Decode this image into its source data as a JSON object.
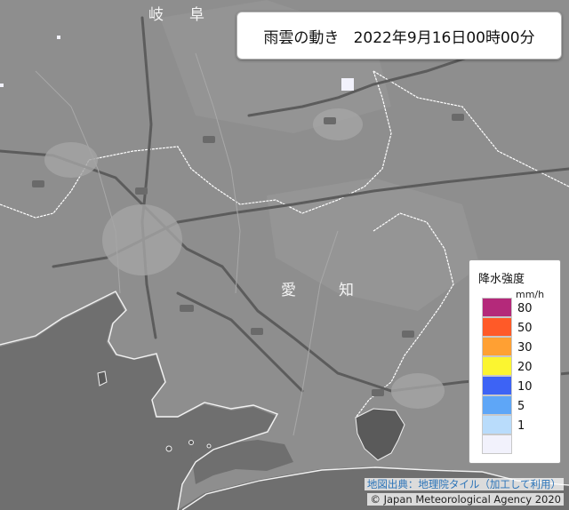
{
  "title": {
    "label": "雨雲の動き",
    "datetime": "2022年9月16日00時00分"
  },
  "map": {
    "place_labels": [
      {
        "id": "gifu-1",
        "text": "岐"
      },
      {
        "id": "gifu-2",
        "text": "阜"
      },
      {
        "id": "aichi-1",
        "text": "愛"
      },
      {
        "id": "aichi-2",
        "text": "知"
      }
    ]
  },
  "legend": {
    "title": "降水強度",
    "unit": "mm/h",
    "levels": [
      {
        "label": "80",
        "color": "#b4297a"
      },
      {
        "label": "50",
        "color": "#ff5a28"
      },
      {
        "label": "30",
        "color": "#ffa033"
      },
      {
        "label": "20",
        "color": "#fbf530"
      },
      {
        "label": "10",
        "color": "#3d63f5"
      },
      {
        "label": "5",
        "color": "#5ea6f7"
      },
      {
        "label": "1",
        "color": "#b9dcfb"
      },
      {
        "label": "",
        "color": "#f2f2fc"
      }
    ]
  },
  "credits": {
    "source": "地図出典：地理院タイル（加工して利用）",
    "copyright": "© Japan Meteorological Agency 2020"
  }
}
